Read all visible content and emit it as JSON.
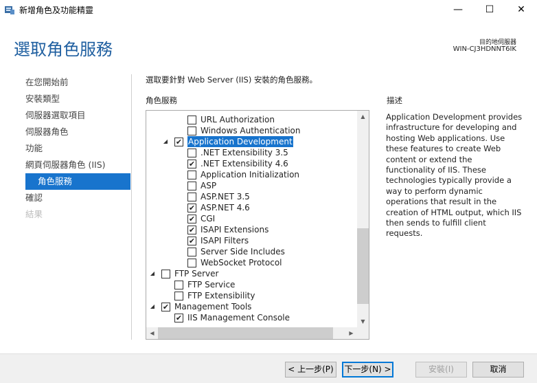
{
  "window": {
    "title": "新增角色及功能精靈",
    "minimize_glyph": "—",
    "maximize_glyph": "☐",
    "close_glyph": "✕"
  },
  "header": {
    "page_title": "選取角色服務",
    "dest_label": "目的地伺服器",
    "dest_server": "WIN-CJ3HDNNT6IK"
  },
  "nav": {
    "items": [
      {
        "label": "在您開始前",
        "state": "normal"
      },
      {
        "label": "安裝類型",
        "state": "normal"
      },
      {
        "label": "伺服器選取項目",
        "state": "normal"
      },
      {
        "label": "伺服器角色",
        "state": "normal"
      },
      {
        "label": "功能",
        "state": "normal"
      },
      {
        "label": "網頁伺服器角色 (IIS)",
        "state": "normal"
      },
      {
        "label": "角色服務",
        "state": "active"
      },
      {
        "label": "確認",
        "state": "normal"
      },
      {
        "label": "結果",
        "state": "disabled"
      }
    ]
  },
  "main": {
    "intro": "選取要針對 Web Server (IIS) 安裝的角色服務。",
    "role_services_heading": "角色服務",
    "description_heading": "描述",
    "description_text": "Application Development provides infrastructure for developing and hosting Web applications. Use these features to create Web content or extend the functionality of IIS. These technologies typically provide a way to perform dynamic operations that result in the creation of HTML output, which IIS then sends to fulfill client requests."
  },
  "tree": {
    "items": [
      {
        "label": "URL Authorization",
        "checked": false,
        "expander": ""
      },
      {
        "label": "Windows Authentication",
        "checked": false,
        "expander": ""
      },
      {
        "label": "Application Development",
        "checked": true,
        "expander": "◢",
        "selected": true
      },
      {
        "label": ".NET Extensibility 3.5",
        "checked": false,
        "expander": ""
      },
      {
        "label": ".NET Extensibility 4.6",
        "checked": true,
        "expander": ""
      },
      {
        "label": "Application Initialization",
        "checked": false,
        "expander": ""
      },
      {
        "label": "ASP",
        "checked": false,
        "expander": ""
      },
      {
        "label": "ASP.NET 3.5",
        "checked": false,
        "expander": ""
      },
      {
        "label": "ASP.NET 4.6",
        "checked": true,
        "expander": ""
      },
      {
        "label": "CGI",
        "checked": true,
        "expander": ""
      },
      {
        "label": "ISAPI Extensions",
        "checked": true,
        "expander": ""
      },
      {
        "label": "ISAPI Filters",
        "checked": true,
        "expander": ""
      },
      {
        "label": "Server Side Includes",
        "checked": false,
        "expander": ""
      },
      {
        "label": "WebSocket Protocol",
        "checked": false,
        "expander": ""
      },
      {
        "label": "FTP Server",
        "checked": false,
        "expander": "◢"
      },
      {
        "label": "FTP Service",
        "checked": false,
        "expander": ""
      },
      {
        "label": "FTP Extensibility",
        "checked": false,
        "expander": ""
      },
      {
        "label": "Management Tools",
        "checked": true,
        "expander": "◢"
      },
      {
        "label": "IIS Management Console",
        "checked": true,
        "expander": ""
      }
    ],
    "check_glyph": "✔",
    "scroll_up_glyph": "▲",
    "scroll_down_glyph": "▼",
    "scroll_left_glyph": "◀",
    "scroll_right_glyph": "▶"
  },
  "footer": {
    "prev_label": "< 上一步(P)",
    "next_label": "下一步(N) >",
    "install_label": "安裝(I)",
    "cancel_label": "取消"
  },
  "colors": {
    "accent": "#1874cd",
    "title_blue": "#1f5fa0"
  }
}
